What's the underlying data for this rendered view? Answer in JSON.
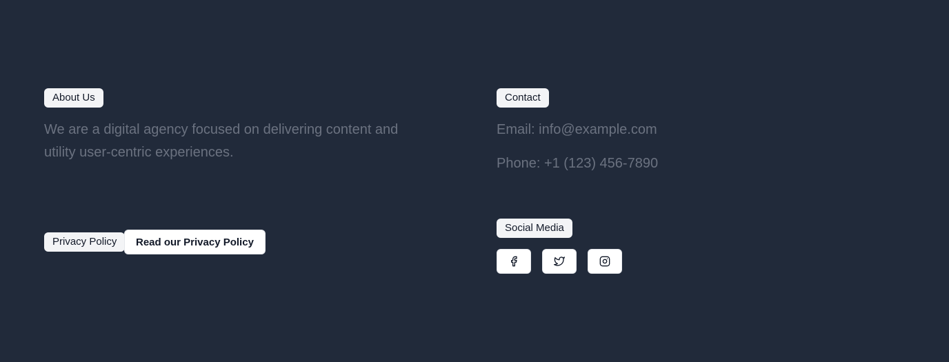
{
  "about": {
    "heading": "About Us",
    "text_line1": "We are a digital agency focused on delivering content and",
    "text_line2": "utility user-centric experiences."
  },
  "privacy": {
    "label": "Privacy Policy",
    "button_label": "Read our Privacy Policy"
  },
  "contact": {
    "heading": "Contact",
    "email": "Email: info@example.com",
    "phone": "Phone: +1 (123) 456-7890"
  },
  "social": {
    "heading": "Social Media",
    "icons": [
      "facebook-icon",
      "twitter-icon",
      "instagram-icon"
    ]
  },
  "colors": {
    "background": "#212a3a",
    "badge_bg": "#f3f4f6",
    "muted_text": "#6b7280",
    "button_bg": "#ffffff"
  }
}
